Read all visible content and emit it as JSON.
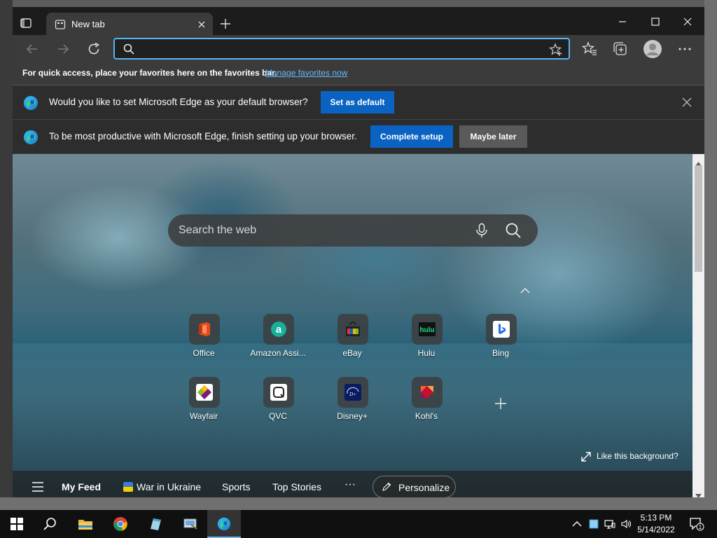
{
  "tab": {
    "title": "New tab"
  },
  "address": {
    "value": "",
    "placeholder": ""
  },
  "favorites_bar": {
    "text": "For quick access, place your favorites here on the favorites bar.",
    "link": "Manage favorites now"
  },
  "default_prompt": {
    "text": "Would you like to set Microsoft Edge as your default browser?",
    "button": "Set as default"
  },
  "setup_prompt": {
    "text": "To be most productive with Microsoft Edge, finish setting up your browser.",
    "primary_button": "Complete setup",
    "secondary_button": "Maybe later"
  },
  "newtab": {
    "search_placeholder": "Search the web",
    "quick_links": [
      {
        "label": "Office",
        "icon": "office-icon"
      },
      {
        "label": "Amazon Assi...",
        "icon": "amazon-icon"
      },
      {
        "label": "eBay",
        "icon": "ebay-icon"
      },
      {
        "label": "Hulu",
        "icon": "hulu-icon"
      },
      {
        "label": "Bing",
        "icon": "bing-icon"
      },
      {
        "label": "Wayfair",
        "icon": "wayfair-icon"
      },
      {
        "label": "QVC",
        "icon": "qvc-icon"
      },
      {
        "label": "Disney+",
        "icon": "disney-icon"
      },
      {
        "label": "Kohl's",
        "icon": "kohls-icon"
      }
    ],
    "hulu_logo": "hulu",
    "like_background": "Like this background?",
    "feed": {
      "items": [
        "My Feed",
        "War in Ukraine",
        "Sports",
        "Top Stories"
      ],
      "more": "···",
      "personalize": "Personalize"
    }
  },
  "taskbar": {
    "apps": [
      "start-icon",
      "search-icon",
      "file-explorer-icon",
      "chrome-icon",
      "notepad-icon",
      "control-panel-icon",
      "edge-icon"
    ],
    "time": "5:13 PM",
    "date": "5/14/2022",
    "notification_count": "1"
  },
  "colors": {
    "accent": "#0a63c2",
    "address_border": "#5ab3f5",
    "link": "#68b8f5"
  }
}
